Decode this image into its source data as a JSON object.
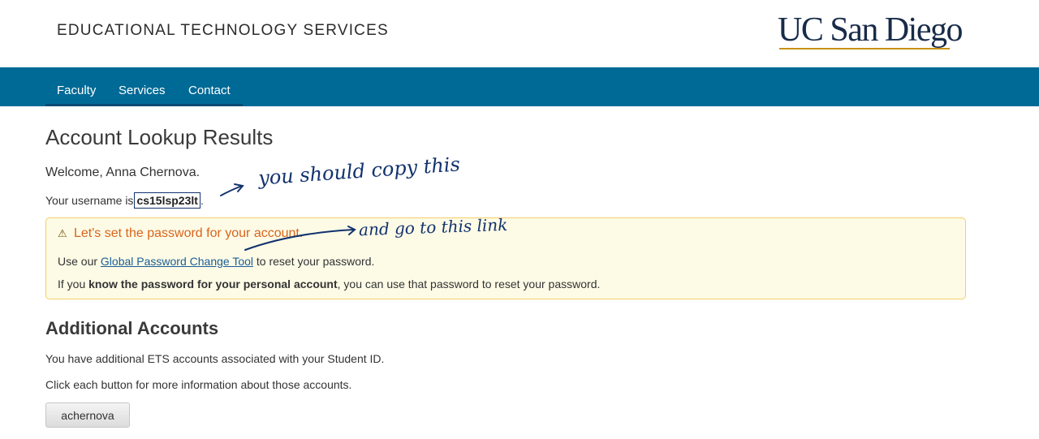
{
  "header": {
    "site_title": "EDUCATIONAL TECHNOLOGY SERVICES",
    "logo_text": "UC San Diego"
  },
  "nav": {
    "items": [
      {
        "label": "Faculty"
      },
      {
        "label": "Services"
      },
      {
        "label": "Contact"
      }
    ]
  },
  "main": {
    "title": "Account Lookup Results",
    "welcome": "Welcome, Anna Chernova.",
    "username_prefix": "Your username is",
    "username": "cs15lsp23lt",
    "username_suffix": "."
  },
  "alert": {
    "icon": "warning-icon",
    "title": "Let's set the password for your account.",
    "line1_prefix": "Use our ",
    "line1_link": "Global Password Change Tool",
    "line1_suffix": " to reset your password.",
    "line2_prefix": "If you ",
    "line2_bold": "know the password for your personal account",
    "line2_suffix": ", you can use that password to reset your password."
  },
  "additional": {
    "title": "Additional Accounts",
    "para1": "You have additional ETS accounts associated with your Student ID.",
    "para2": "Click each button for more information about those accounts.",
    "accounts": [
      "achernova"
    ]
  },
  "annotations": {
    "note1": "you should copy this",
    "note2": "and go to this link"
  },
  "colors": {
    "nav_bg": "#006a96",
    "logo": "#182b49",
    "logo_accent": "#c69214",
    "alert_bg": "#fdfbe6",
    "alert_border": "#f2ce6a",
    "alert_title": "#d9641c",
    "annotation_ink": "#12326e"
  }
}
